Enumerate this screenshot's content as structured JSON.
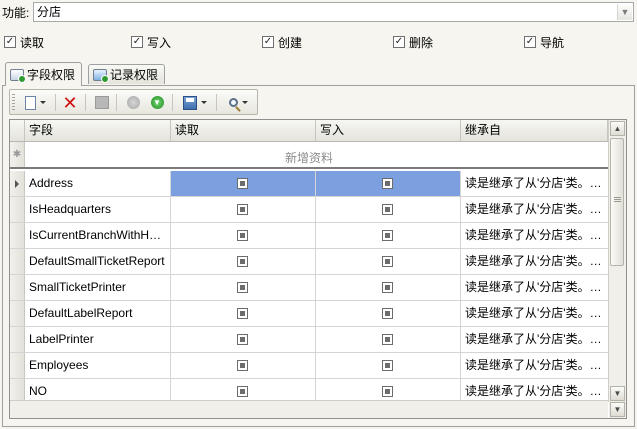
{
  "function_label": "功能:",
  "function_value": "分店",
  "permissions": {
    "read": "读取",
    "write": "写入",
    "create": "创建",
    "delete": "删除",
    "navigate": "导航"
  },
  "tabs": [
    {
      "label": "字段权限",
      "active": true
    },
    {
      "label": "记录权限",
      "active": false
    }
  ],
  "toolbar": {
    "icons": [
      "new-icon",
      "delete-icon",
      "save-icon",
      "circle-icon",
      "download-icon",
      "disk-icon",
      "search-icon"
    ]
  },
  "grid": {
    "columns": [
      "字段",
      "读取",
      "写入",
      "继承自"
    ],
    "new_row_text": "新增资料",
    "rows": [
      {
        "field": "Address",
        "read": true,
        "write": true,
        "inherit": "读是继承了从'分店'类。…",
        "selected": true
      },
      {
        "field": "IsHeadquarters",
        "read": true,
        "write": true,
        "inherit": "读是继承了从'分店'类。…"
      },
      {
        "field": "IsCurrentBranchWithH…",
        "read": true,
        "write": true,
        "inherit": "读是继承了从'分店'类。…"
      },
      {
        "field": "DefaultSmallTicketReport",
        "read": true,
        "write": true,
        "inherit": "读是继承了从'分店'类。…"
      },
      {
        "field": "SmallTicketPrinter",
        "read": true,
        "write": true,
        "inherit": "读是继承了从'分店'类。…"
      },
      {
        "field": "DefaultLabelReport",
        "read": true,
        "write": true,
        "inherit": "读是继承了从'分店'类。…"
      },
      {
        "field": "LabelPrinter",
        "read": true,
        "write": true,
        "inherit": "读是继承了从'分店'类。…"
      },
      {
        "field": "Employees",
        "read": true,
        "write": true,
        "inherit": "读是继承了从'分店'类。…"
      },
      {
        "field": "NO",
        "read": true,
        "write": true,
        "inherit": "读是继承了从'分店'类。…"
      }
    ]
  },
  "colors": {
    "selection": "#7c9fe0",
    "background": "#f6f5ef"
  }
}
